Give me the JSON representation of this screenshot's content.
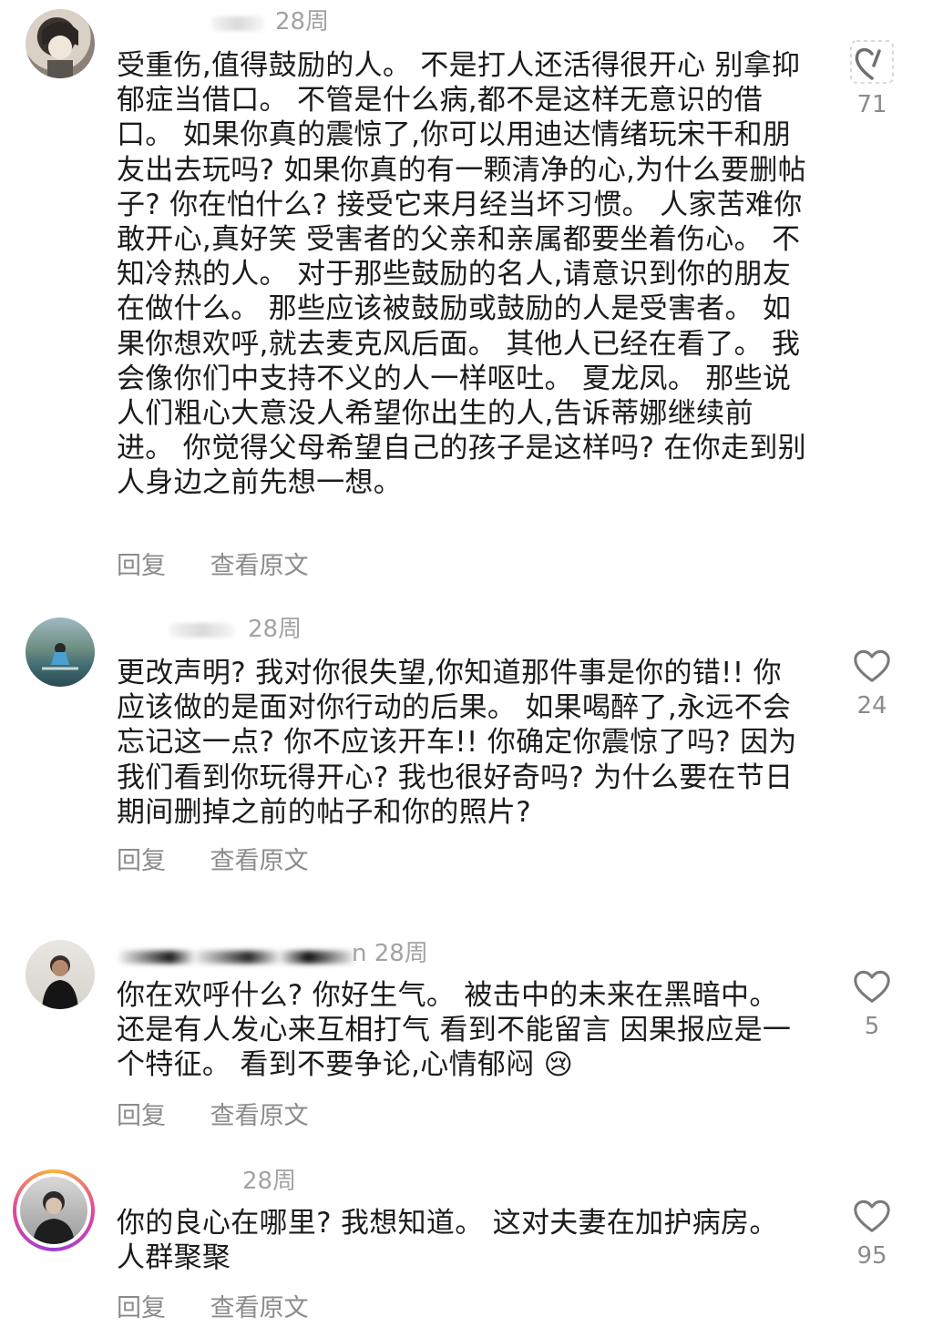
{
  "comments": [
    {
      "time": "28周",
      "text": "受重伤,值得鼓励的人。 不是打人还活得很开心 别拿抑郁症当借口。 不管是什么病,都不是这样无意识的借口。 如果你真的震惊了,你可以用迪达情绪玩宋干和朋友出去玩吗? 如果你真的有一颗清净的心,为什么要删帖子? 你在怕什么? 接受它来月经当坏习惯。 人家苦难你敢开心,真好笑 受害者的父亲和亲属都要坐着伤心。 不知冷热的人。 对于那些鼓励的名人,请意识到你的朋友在做什么。 那些应该被鼓励或鼓励的人是受害者。 如果你想欢呼,就去麦克风后面。 其他人已经在看了。 我会像你们中支持不义的人一样呕吐。 夏龙凤。 那些说人们粗心大意没人希望你出生的人,告诉蒂娜继续前进。 你觉得父母希望自己的孩子是这样吗? 在你走到别人身边之前先想一想。",
      "reply": "回复",
      "view_original": "查看原文",
      "likes": "71"
    },
    {
      "time": "28周",
      "text": "更改声明? 我对你很失望,你知道那件事是你的错!! 你应该做的是面对你行动的后果。 如果喝醉了,永远不会忘记这一点? 你不应该开车!! 你确定你震惊了吗? 因为我们看到你玩得开心? 我也很好奇吗? 为什么要在节日期间删掉之前的帖子和你的照片?",
      "reply": "回复",
      "view_original": "查看原文",
      "likes": "24"
    },
    {
      "time": "n 28周",
      "text": "你在欢呼什么? 你好生气。 被击中的未来在黑暗中。 还是有人发心来互相打气 看到不能留言 因果报应是一个特征。 看到不要争论,心情郁闷 😢",
      "reply": "回复",
      "view_original": "查看原文",
      "likes": "5"
    },
    {
      "time": "28周",
      "text": "你的良心在哪里? 我想知道。 这对夫妻在加护病房。 人群聚聚",
      "reply": "回复",
      "view_original": "查看原文",
      "likes": "95"
    }
  ],
  "icons": {
    "like": "heart-outline-icon",
    "liked_partial": "heart-half-icon"
  },
  "colors": {
    "text": "#1b1b1b",
    "meta": "#a3a3a3",
    "action": "#8b8b8b",
    "story_ring": "#e0489a"
  }
}
